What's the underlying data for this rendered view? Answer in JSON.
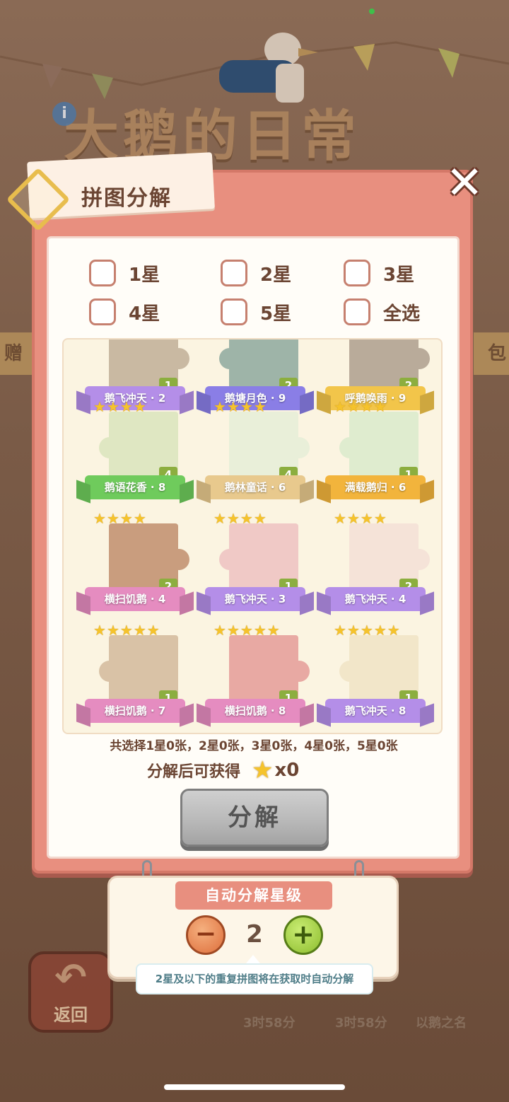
{
  "background": {
    "game_title": "大鹅的日常",
    "info_icon": "i",
    "side_left": "赠",
    "side_right": "包",
    "back_label": "返回",
    "timers": [
      "3时58分",
      "3时58分"
    ],
    "bottom_name": "以鹅之名"
  },
  "dialog": {
    "title": "拼图分解",
    "close_label": "✕"
  },
  "filters": [
    {
      "label": "1星"
    },
    {
      "label": "2星"
    },
    {
      "label": "3星"
    },
    {
      "label": "4星"
    },
    {
      "label": "5星"
    },
    {
      "label": "全选"
    }
  ],
  "cards": [
    {
      "name": "鹅飞冲天 · 2",
      "count": "1",
      "stars": 0
    },
    {
      "name": "鹅塘月色 · 9",
      "count": "2",
      "stars": 0
    },
    {
      "name": "呼鹅唤雨 · 9",
      "count": "2",
      "stars": 0
    },
    {
      "name": "鹅语花香 · 8",
      "count": "4",
      "stars": 4
    },
    {
      "name": "鹅林童话 · 6",
      "count": "4",
      "stars": 4
    },
    {
      "name": "满载鹅归 · 6",
      "count": "1",
      "stars": 4
    },
    {
      "name": "横扫饥鹅 · 4",
      "count": "2",
      "stars": 4
    },
    {
      "name": "鹅飞冲天 · 3",
      "count": "1",
      "stars": 4
    },
    {
      "name": "鹅飞冲天 · 4",
      "count": "2",
      "stars": 4
    },
    {
      "name": "横扫饥鹅 · 7",
      "count": "1",
      "stars": 5
    },
    {
      "name": "横扫饥鹅 · 8",
      "count": "1",
      "stars": 5
    },
    {
      "name": "鹅飞冲天 · 8",
      "count": "1",
      "stars": 5
    }
  ],
  "ribbon_colors": [
    "#b48ee8",
    "#8a7ee6",
    "#f2c54a",
    "#6fcb5c",
    "#e8c98d",
    "#f2b43c",
    "#e58cc0",
    "#b48ee8",
    "#b48ee8",
    "#e58cc0",
    "#e58cc0",
    "#b48ee8"
  ],
  "summary": {
    "selected_text": "共选择1星0张，2星0张，3星0张，4星0张，5星0张",
    "gain_label": "分解后可获得",
    "gain_value": "x0"
  },
  "decompose_button": "分解",
  "auto_decompose": {
    "title": "自动分解星级",
    "minus": "−",
    "plus": "+",
    "level": "2",
    "hint": "2星及以下的重复拼图将在获取时自动分解"
  }
}
